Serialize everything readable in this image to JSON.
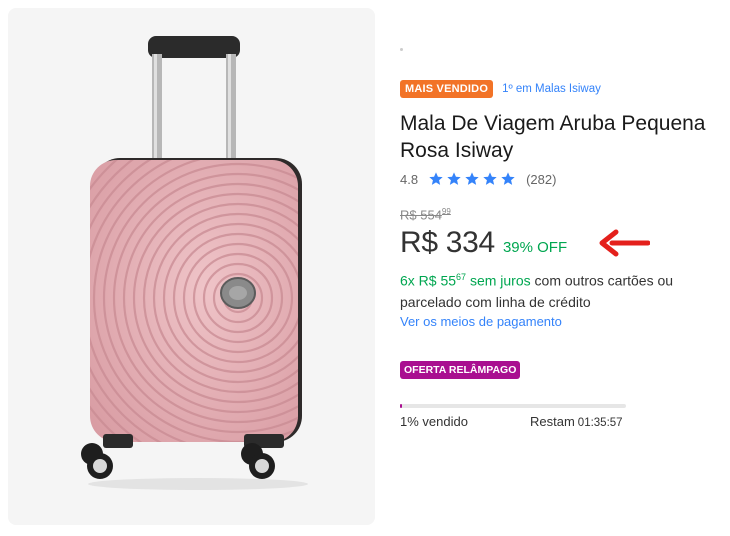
{
  "product": {
    "badge": "MAIS VENDIDO",
    "rank": "1º em Malas Isiway",
    "title": "Mala De Viagem Aruba Pequena Rosa Isiway",
    "rating": "4.8",
    "stars": 5,
    "reviews": "(282)",
    "old_price_main": "R$ 554",
    "old_price_cents": "99",
    "price": "R$ 334",
    "discount": "39% OFF",
    "installments_prefix": "6x R$ 55",
    "installments_cents": "67",
    "installments_suffix": " sem juros",
    "installments_extra": " com outros cartões ou parcelado com linha de crédito",
    "payment_link": "Ver os meios de pagamento"
  },
  "flash": {
    "badge": "OFERTA RELÂMPAGO",
    "sold_percent": 1,
    "sold_label": "1% vendido",
    "remaining_label": "Restam",
    "timer": "01:35:57"
  },
  "colors": {
    "accent_blue": "#3483fa",
    "green": "#00a650",
    "orange": "#f27327",
    "purple": "#a90f90",
    "arrow_red": "#e4201c",
    "suitcase_pink": "#e3adb3"
  },
  "icons": {
    "star": "star-icon",
    "arrow": "left-arrow-icon"
  }
}
